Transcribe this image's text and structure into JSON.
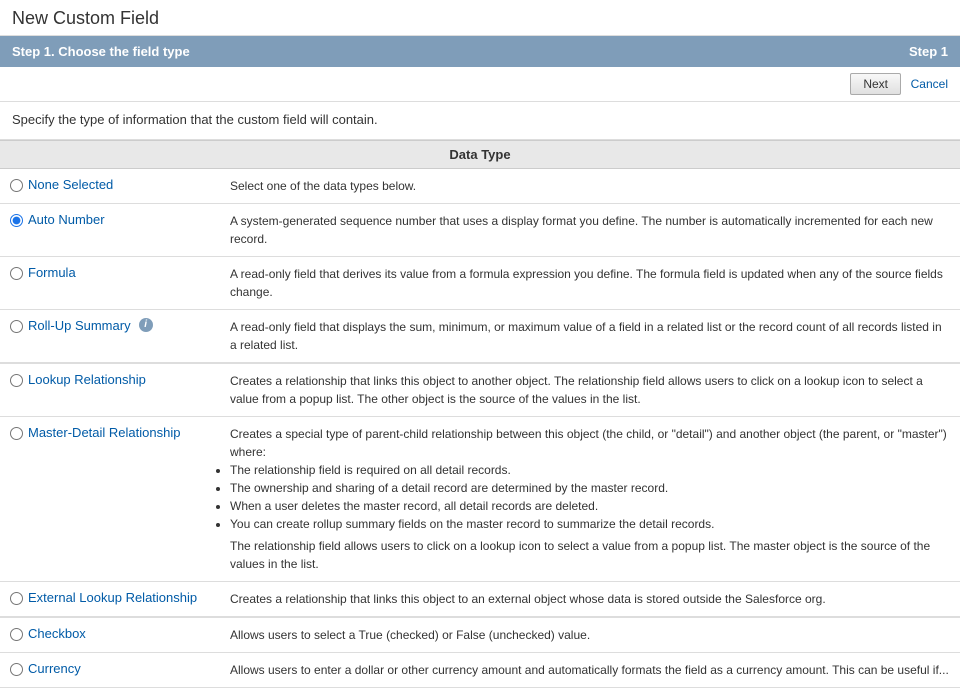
{
  "page": {
    "title": "New Custom Field"
  },
  "step_header": {
    "left": "Step 1. Choose the field type",
    "right": "Step 1"
  },
  "buttons": {
    "next": "Next",
    "cancel": "Cancel"
  },
  "intro": "Specify the type of information that the custom field will contain.",
  "table": {
    "column_header": "Data Type",
    "rows": [
      {
        "id": "none-selected",
        "label": "None Selected",
        "selected": false,
        "description": "Select one of the data types below."
      },
      {
        "id": "auto-number",
        "label": "Auto Number",
        "selected": true,
        "description": "A system-generated sequence number that uses a display format you define. The number is automatically incremented for each new record."
      },
      {
        "id": "formula",
        "label": "Formula",
        "selected": false,
        "description": "A read-only field that derives its value from a formula expression you define. The formula field is updated when any of the source fields change."
      },
      {
        "id": "roll-up-summary",
        "label": "Roll-Up Summary",
        "selected": false,
        "has_info": true,
        "description": "A read-only field that displays the sum, minimum, or maximum value of a field in a related list or the record count of all records listed in a related list."
      },
      {
        "id": "lookup-relationship",
        "label": "Lookup Relationship",
        "selected": false,
        "section_divider": true,
        "description": "Creates a relationship that links this object to another object. The relationship field allows users to click on a lookup icon to select a value from a popup list. The other object is the source of the values in the list."
      },
      {
        "id": "master-detail-relationship",
        "label": "Master-Detail Relationship",
        "selected": false,
        "description": "Creates a special type of parent-child relationship between this object (the child, or \"detail\") and another object (the parent, or \"master\") where:",
        "bullets": [
          "The relationship field is required on all detail records.",
          "The ownership and sharing of a detail record are determined by the master record.",
          "When a user deletes the master record, all detail records are deleted.",
          "You can create rollup summary fields on the master record to summarize the detail records."
        ],
        "description_after": "The relationship field allows users to click on a lookup icon to select a value from a popup list. The master object is the source of the values in the list."
      },
      {
        "id": "external-lookup-relationship",
        "label": "External Lookup Relationship",
        "selected": false,
        "description": "Creates a relationship that links this object to an external object whose data is stored outside the Salesforce org."
      },
      {
        "id": "checkbox",
        "label": "Checkbox",
        "selected": false,
        "section_divider": true,
        "description": "Allows users to select a True (checked) or False (unchecked) value."
      },
      {
        "id": "currency",
        "label": "Currency",
        "selected": false,
        "description": "Allows users to enter a dollar or other currency amount and automatically formats the field as a currency amount. This can be useful if..."
      }
    ]
  }
}
